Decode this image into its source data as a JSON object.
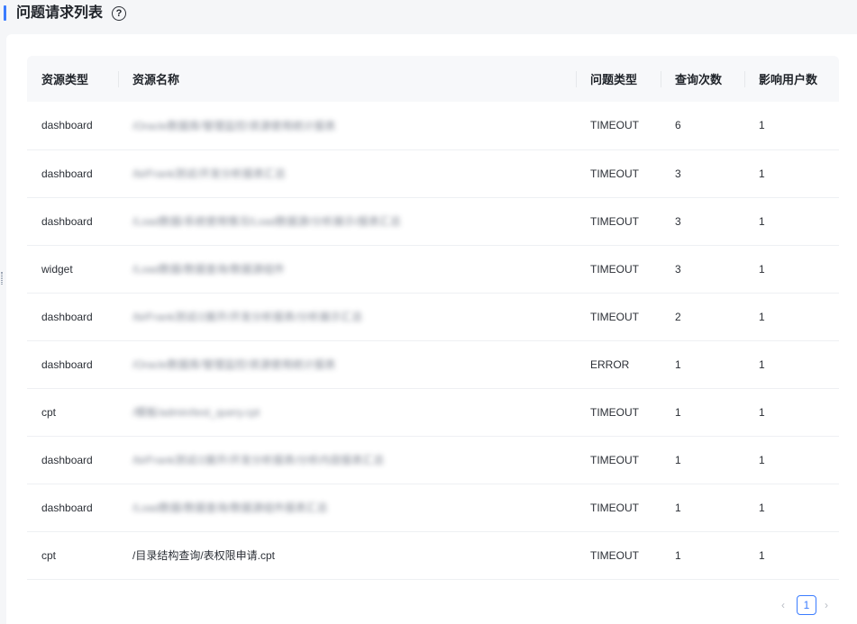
{
  "header": {
    "title": "问题请求列表",
    "help_glyph": "?"
  },
  "table": {
    "columns": [
      "资源类型",
      "资源名称",
      "问题类型",
      "查询次数",
      "影响用户数"
    ],
    "rows": [
      {
        "type": "dashboard",
        "name": "/Oracle数据库/管理监控/资源使用统计报表",
        "problem": "TIMEOUT",
        "count": "6",
        "users": "1",
        "blurred": true
      },
      {
        "type": "dashboard",
        "name": "/bi/Frank测试/开发分析报表汇总",
        "problem": "TIMEOUT",
        "count": "3",
        "users": "1",
        "blurred": true
      },
      {
        "type": "dashboard",
        "name": "/Load数据/系统使用情况/Load数据源/分析展示/报表汇总",
        "problem": "TIMEOUT",
        "count": "3",
        "users": "1",
        "blurred": true
      },
      {
        "type": "widget",
        "name": "/Load数据/数据查询/数据源组件",
        "problem": "TIMEOUT",
        "count": "3",
        "users": "1",
        "blurred": true
      },
      {
        "type": "dashboard",
        "name": "/bi/Frank测试/2展开/开发分析报表/分析展示汇总",
        "problem": "TIMEOUT",
        "count": "2",
        "users": "1",
        "blurred": true
      },
      {
        "type": "dashboard",
        "name": "/Oracle数据库/管理监控/资源使用统计报表",
        "problem": "ERROR",
        "count": "1",
        "users": "1",
        "blurred": true
      },
      {
        "type": "cpt",
        "name": "/模板/admin/test_query.cpt",
        "problem": "TIMEOUT",
        "count": "1",
        "users": "1",
        "blurred": true
      },
      {
        "type": "dashboard",
        "name": "/bi/Frank测试/2展开/开发分析报表/分析内容报表汇总",
        "problem": "TIMEOUT",
        "count": "1",
        "users": "1",
        "blurred": true
      },
      {
        "type": "dashboard",
        "name": "/Load数据/数据查询/数据源组件报表汇总",
        "problem": "TIMEOUT",
        "count": "1",
        "users": "1",
        "blurred": true
      },
      {
        "type": "cpt",
        "name": "/目录结构查询/表权限申请.cpt",
        "problem": "TIMEOUT",
        "count": "1",
        "users": "1",
        "blurred": false
      }
    ]
  },
  "pagination": {
    "prev_glyph": "‹",
    "current": "1",
    "next_glyph": "›"
  },
  "colors": {
    "accent": "#3b7cff",
    "header_bg": "#f7f8fa",
    "page_bg": "#f5f6f8"
  }
}
